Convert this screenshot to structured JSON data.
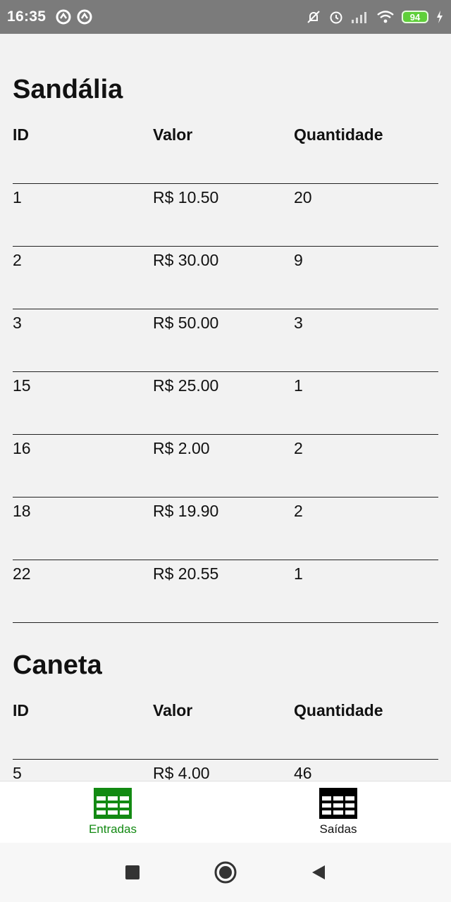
{
  "status_bar": {
    "time": "16:35",
    "battery": "94",
    "icons": [
      "app-notification-icon",
      "app-notification-icon",
      "silent-icon",
      "alarm-icon",
      "signal-icon",
      "wifi-icon",
      "battery-icon",
      "charging-icon"
    ]
  },
  "sections": [
    {
      "title": "Sandália",
      "headers": {
        "id": "ID",
        "valor": "Valor",
        "quantidade": "Quantidade"
      },
      "rows": [
        {
          "id": "1",
          "valor": "R$ 10.50",
          "quantidade": "20"
        },
        {
          "id": "2",
          "valor": "R$ 30.00",
          "quantidade": "9"
        },
        {
          "id": "3",
          "valor": "R$ 50.00",
          "quantidade": "3"
        },
        {
          "id": "15",
          "valor": "R$ 25.00",
          "quantidade": "1"
        },
        {
          "id": "16",
          "valor": "R$ 2.00",
          "quantidade": "2"
        },
        {
          "id": "18",
          "valor": "R$ 19.90",
          "quantidade": "2"
        },
        {
          "id": "22",
          "valor": "R$ 20.55",
          "quantidade": "1"
        }
      ]
    },
    {
      "title": "Caneta",
      "headers": {
        "id": "ID",
        "valor": "Valor",
        "quantidade": "Quantidade"
      },
      "rows": [
        {
          "id": "5",
          "valor": "R$ 4.00",
          "quantidade": "46"
        }
      ]
    }
  ],
  "tabs": [
    {
      "label": "Entradas",
      "icon": "table-icon",
      "active": true,
      "color": "#138a13"
    },
    {
      "label": "Saídas",
      "icon": "table-icon",
      "active": false,
      "color": "#000000"
    }
  ],
  "nav": {
    "icons": [
      "recents-square-icon",
      "home-circle-icon",
      "back-triangle-icon"
    ]
  }
}
